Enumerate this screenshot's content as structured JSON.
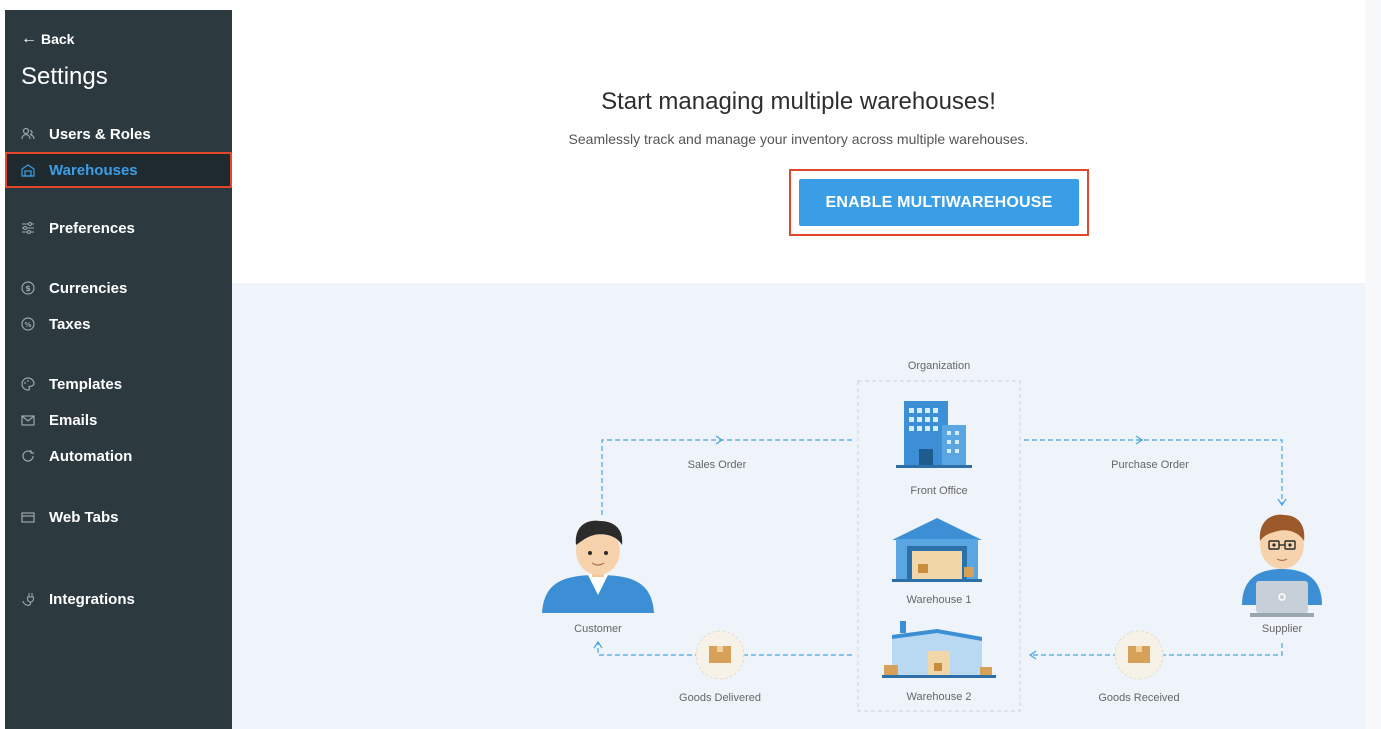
{
  "sidebar": {
    "back_label": "Back",
    "title": "Settings",
    "items": [
      {
        "label": "Users & Roles",
        "icon": "users-icon"
      },
      {
        "label": "Warehouses",
        "icon": "warehouse-icon",
        "active": true
      },
      {
        "label": "Preferences",
        "icon": "sliders-icon"
      },
      {
        "label": "Currencies",
        "icon": "currency-icon"
      },
      {
        "label": "Taxes",
        "icon": "percent-icon"
      },
      {
        "label": "Templates",
        "icon": "palette-icon"
      },
      {
        "label": "Emails",
        "icon": "email-icon"
      },
      {
        "label": "Automation",
        "icon": "refresh-icon"
      },
      {
        "label": "Web Tabs",
        "icon": "tabs-icon"
      },
      {
        "label": "Integrations",
        "icon": "plug-icon"
      }
    ]
  },
  "hero": {
    "title": "Start managing multiple warehouses!",
    "subtitle": "Seamlessly track and manage your inventory across multiple warehouses.",
    "cta_label": "ENABLE MULTIWAREHOUSE"
  },
  "diagram": {
    "organization": "Organization",
    "front_office": "Front Office",
    "warehouse1": "Warehouse 1",
    "warehouse2": "Warehouse 2",
    "customer": "Customer",
    "supplier": "Supplier",
    "sales_order": "Sales Order",
    "purchase_order": "Purchase Order",
    "goods_delivered": "Goods Delivered",
    "goods_received": "Goods Received"
  },
  "colors": {
    "sidebar_bg": "#2c3a40",
    "accent": "#3a9ee6",
    "highlight": "#e2462b"
  }
}
